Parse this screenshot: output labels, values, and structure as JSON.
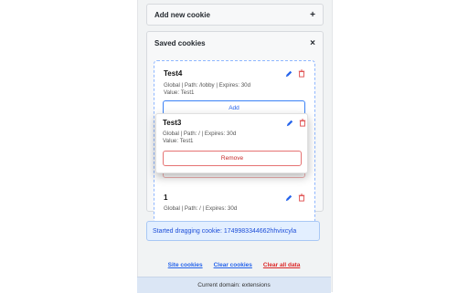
{
  "add_section": {
    "title": "Add new cookie",
    "toggle_glyph": "+"
  },
  "saved_section": {
    "title": "Saved cookies",
    "close_glyph": "×",
    "cookies": [
      {
        "name": "Test4",
        "meta": "Global | Path: /lobby | Expires: 30d",
        "value": "Value: Test1",
        "action_label": "Add"
      },
      {
        "name": "1",
        "meta": "Global | Path: / | Expires: 30d"
      }
    ],
    "ghost_remove_label": "Remove",
    "dragging": {
      "name": "Test3",
      "meta": "Global | Path: / | Expires: 30d",
      "value": "Value: Test1",
      "remove_label": "Remove"
    }
  },
  "status": {
    "text": "Started dragging cookie: 1749983344662hhvixcyla"
  },
  "footer": {
    "links": [
      {
        "label": "Site cookies",
        "color": "#2563eb"
      },
      {
        "label": "Clear cookies",
        "color": "#2563eb"
      },
      {
        "label": "Clear all data",
        "color": "#dc2626"
      }
    ],
    "domain": "Current domain: extensions"
  },
  "icons": {
    "edit": "pencil-icon",
    "delete": "trash-icon"
  },
  "colors": {
    "accent": "#2563eb",
    "danger": "#dc2626",
    "status_bg": "#e3efff"
  }
}
